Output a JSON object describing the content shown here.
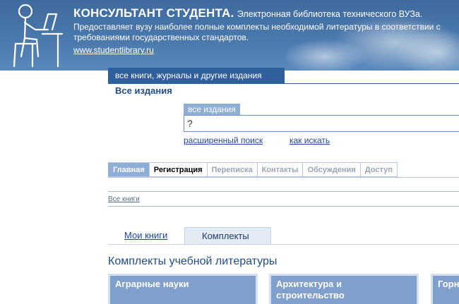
{
  "header": {
    "title_big": "КОНСУЛЬТАНТ СТУДЕНТА.",
    "title_small": "Электронная библиотека технического ВУЗа.",
    "tagline": "Предоставляет вузу наиболее полные комплекты необходимой литературы в соответствии с требованиями государственных стандартов.",
    "url": "www.studentlibrary.ru",
    "logo_icon": "student-at-desk-icon"
  },
  "catalog": {
    "tab_label": "все книги, журналы и другие издания",
    "heading": "Все издания"
  },
  "search": {
    "scope_label": "все издания",
    "value": "?",
    "advanced_link": "расширенный поиск",
    "help_link": "как искать"
  },
  "nav": {
    "tabs": [
      {
        "label": "Главная"
      },
      {
        "label": "Регистрация"
      },
      {
        "label": "Переписка"
      },
      {
        "label": "Контакты"
      },
      {
        "label": "Обсуждения"
      },
      {
        "label": "Доступ"
      }
    ]
  },
  "breadcrumb": "Все книги",
  "subtabs": {
    "my_books": "Мои книги",
    "kits": "Комплекты"
  },
  "section_title": "Комплекты учебной литературы",
  "categories": [
    {
      "label": "Аграрные науки"
    },
    {
      "label": "Архитектура и строительство"
    },
    {
      "label": "Горн"
    }
  ],
  "colors": {
    "header_bg": "#4a78ad",
    "accent_dark": "#2f5f9c",
    "accent_light": "#8eaed6",
    "link": "#1f45a6",
    "card_bg": "#7fa0cc"
  }
}
